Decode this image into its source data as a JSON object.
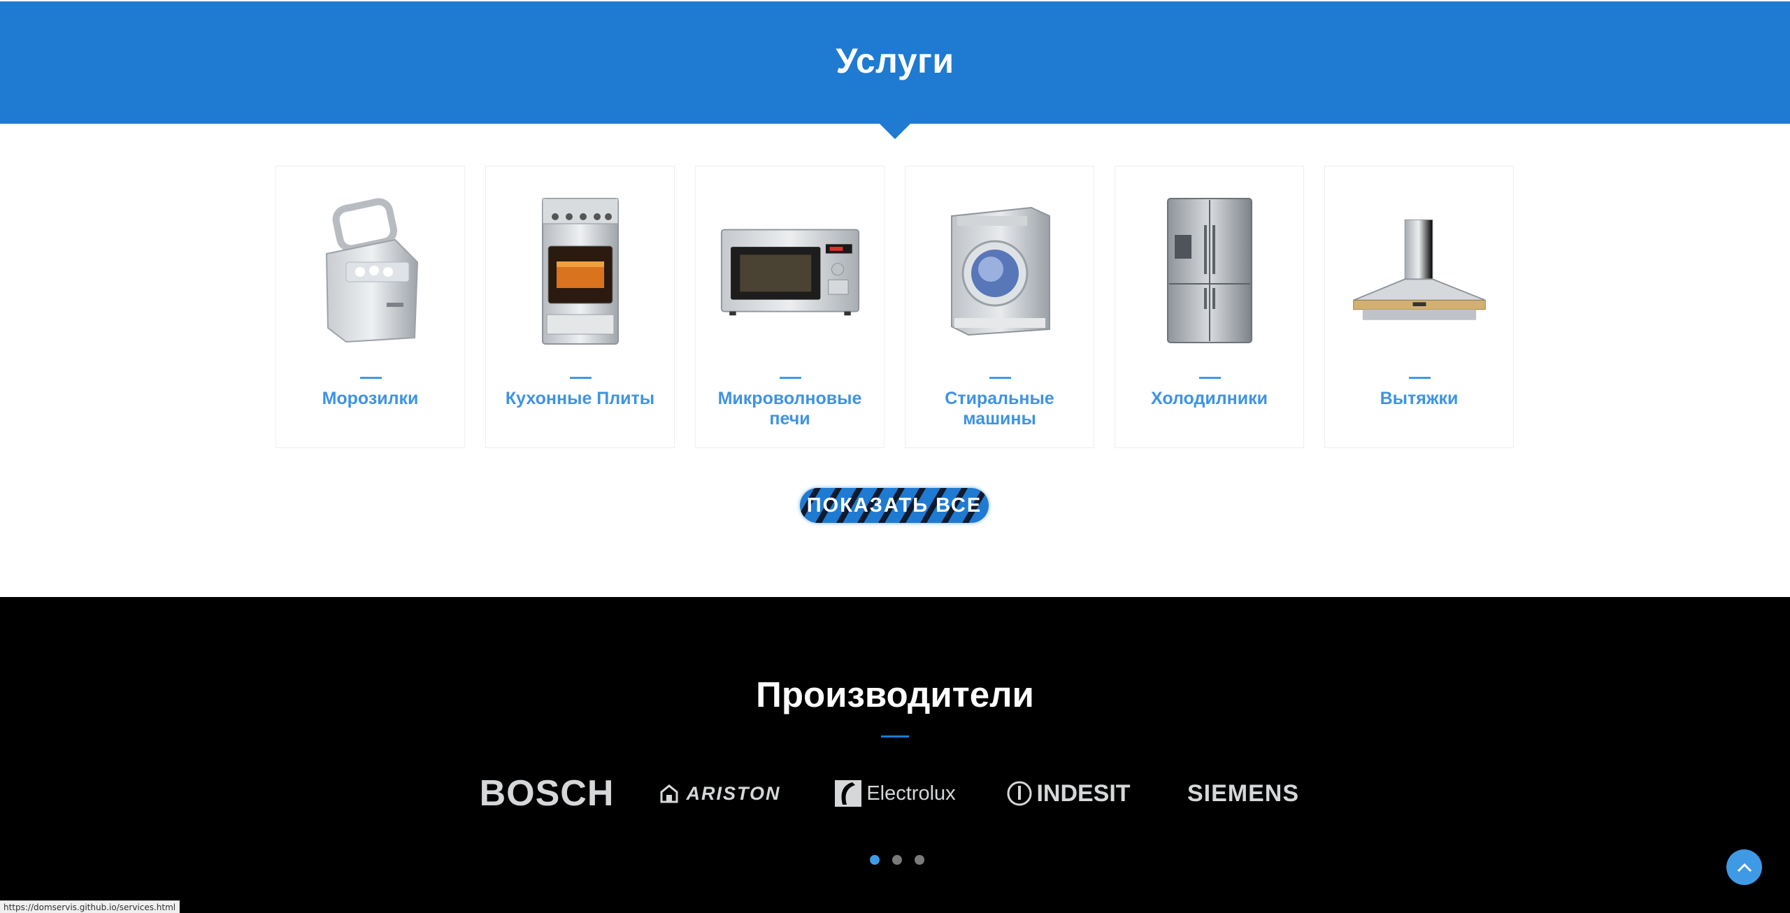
{
  "services": {
    "title": "Услуги",
    "cards": [
      {
        "label": "Морозилки",
        "icon": "ice-maker-icon"
      },
      {
        "label": "Кухонные Плиты",
        "icon": "kitchen-stove-icon"
      },
      {
        "label": "Микроволновые печи",
        "icon": "microwave-icon"
      },
      {
        "label": "Стиральные машины",
        "icon": "washing-machine-icon"
      },
      {
        "label": "Холодилники",
        "icon": "refrigerator-icon"
      },
      {
        "label": "Вытяжки",
        "icon": "range-hood-icon"
      }
    ],
    "show_all_label": "ПОКАЗАТЬ ВСЕ"
  },
  "manufacturers": {
    "title": "Производители",
    "logos": [
      "BOSCH",
      "ARISTON",
      "Electrolux",
      "INDESIT",
      "SIEMENS"
    ],
    "carousel": {
      "pages": 3,
      "active": 1
    }
  },
  "colors": {
    "brand_blue": "#1f7ad2",
    "accent_blue": "#3f93e2",
    "dark_bg": "#000000"
  },
  "status_bar": {
    "url": "https://domservis.github.io/services.html"
  },
  "scroll_top_icon": "chevron-up-icon"
}
